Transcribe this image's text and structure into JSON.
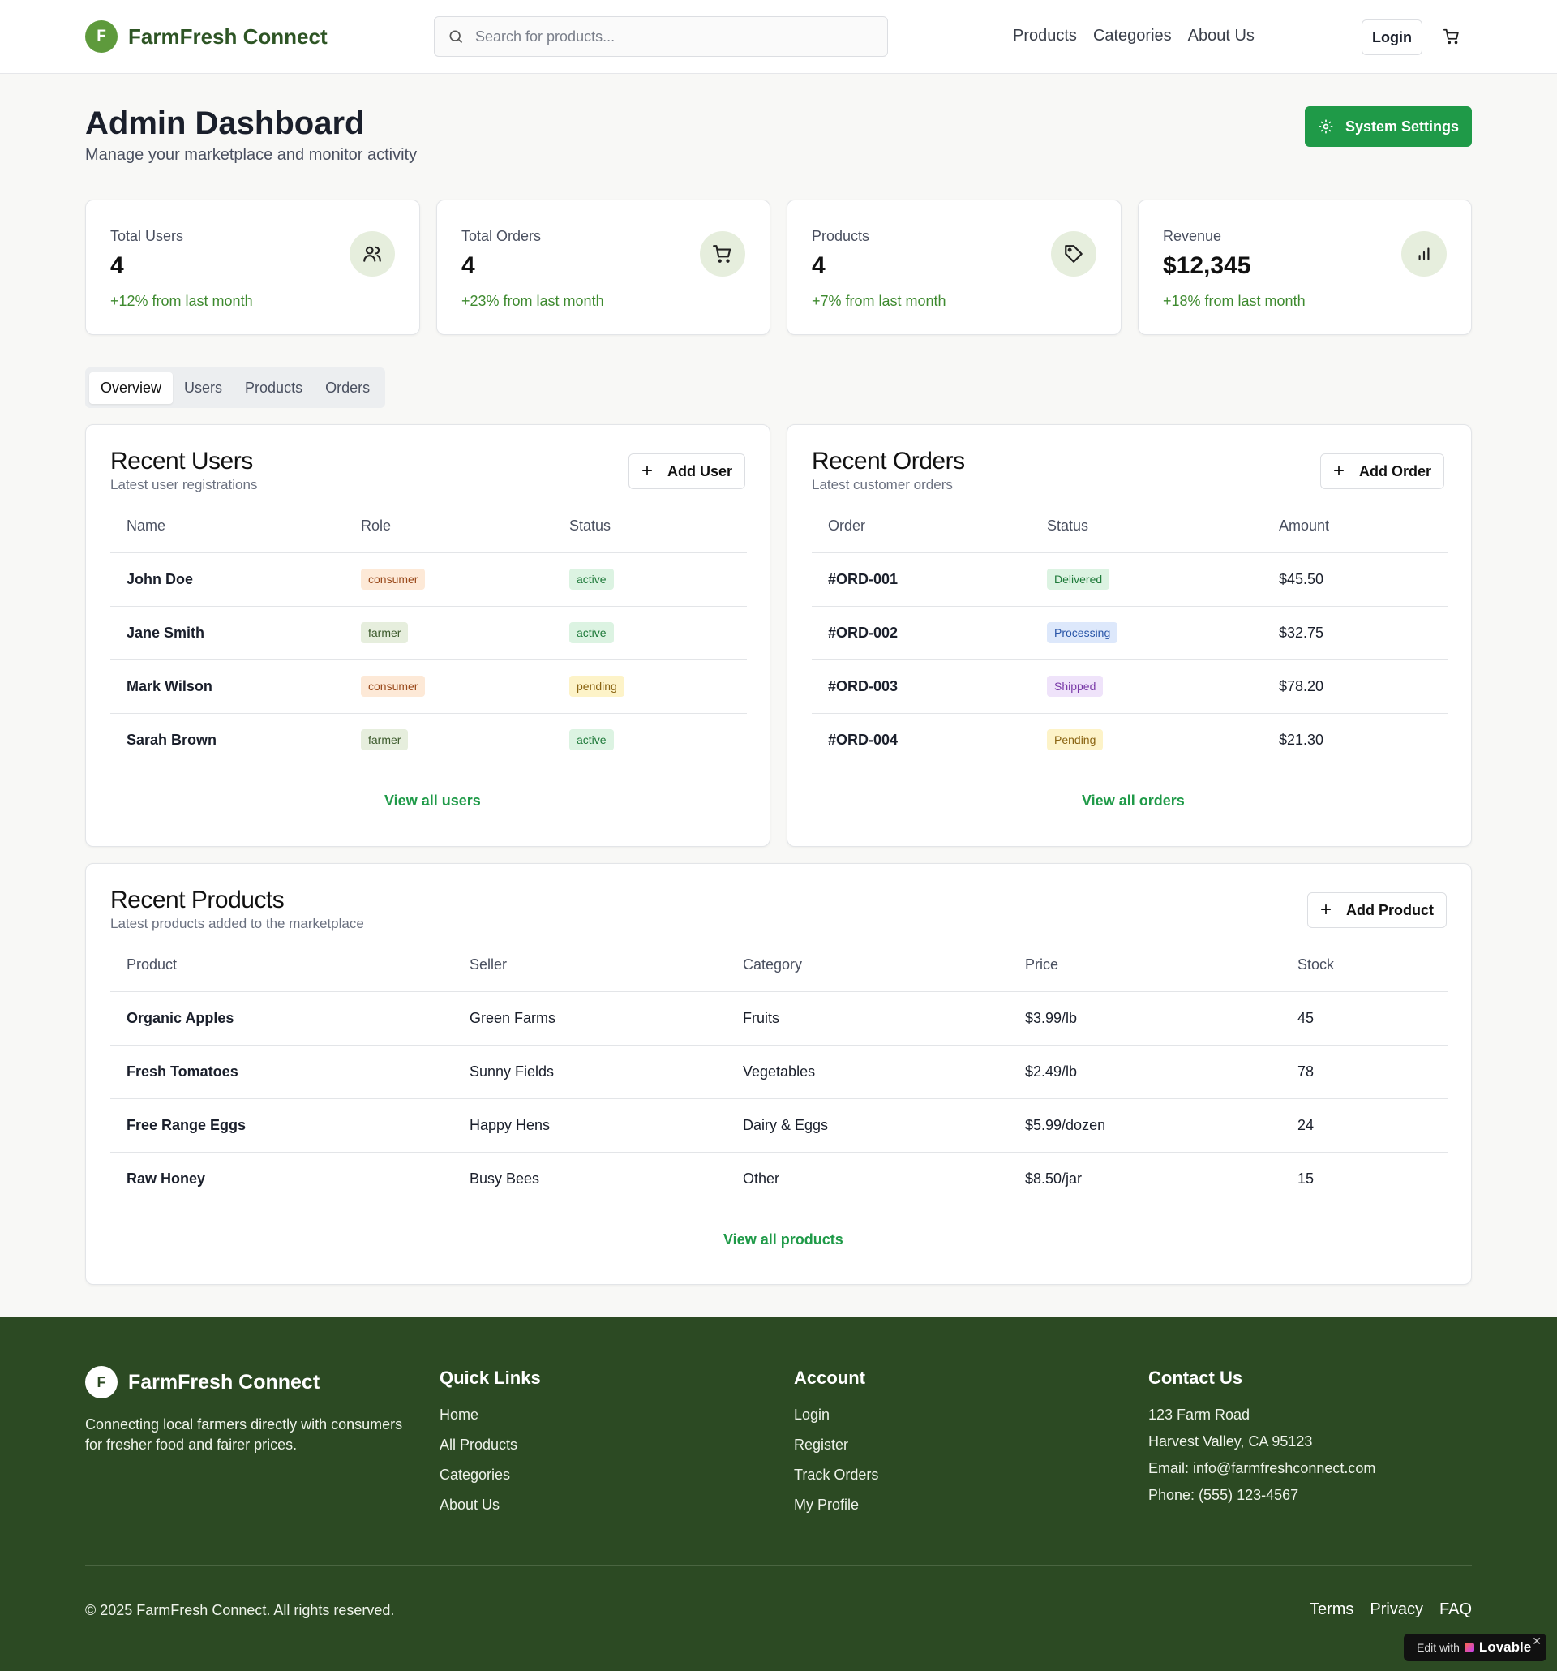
{
  "header": {
    "logo_letter": "F",
    "brand": "FarmFresh Connect",
    "search_placeholder": "Search for products...",
    "nav": [
      "Products",
      "Categories",
      "About Us"
    ],
    "login": "Login"
  },
  "page": {
    "title": "Admin Dashboard",
    "subtitle": "Manage your marketplace and monitor activity",
    "settings_button": "System Settings"
  },
  "stats": [
    {
      "label": "Total Users",
      "value": "4",
      "change": "+12% from last month",
      "icon": "users-icon"
    },
    {
      "label": "Total Orders",
      "value": "4",
      "change": "+23% from last month",
      "icon": "cart-icon"
    },
    {
      "label": "Products",
      "value": "4",
      "change": "+7% from last month",
      "icon": "tag-icon"
    },
    {
      "label": "Revenue",
      "value": "$12,345",
      "change": "+18% from last month",
      "icon": "bar-chart-icon"
    }
  ],
  "tabs": [
    "Overview",
    "Users",
    "Products",
    "Orders"
  ],
  "users": {
    "title": "Recent Users",
    "subtitle": "Latest user registrations",
    "add_label": "Add User",
    "headers": [
      "Name",
      "Role",
      "Status"
    ],
    "rows": [
      {
        "name": "John Doe",
        "role": "consumer",
        "status": "active"
      },
      {
        "name": "Jane Smith",
        "role": "farmer",
        "status": "active"
      },
      {
        "name": "Mark Wilson",
        "role": "consumer",
        "status": "pending"
      },
      {
        "name": "Sarah Brown",
        "role": "farmer",
        "status": "active"
      }
    ],
    "view_all": "View all users"
  },
  "orders": {
    "title": "Recent Orders",
    "subtitle": "Latest customer orders",
    "add_label": "Add Order",
    "headers": [
      "Order",
      "Status",
      "Amount"
    ],
    "rows": [
      {
        "id": "#ORD-001",
        "status": "Delivered",
        "amount": "$45.50"
      },
      {
        "id": "#ORD-002",
        "status": "Processing",
        "amount": "$32.75"
      },
      {
        "id": "#ORD-003",
        "status": "Shipped",
        "amount": "$78.20"
      },
      {
        "id": "#ORD-004",
        "status": "Pending",
        "amount": "$21.30"
      }
    ],
    "view_all": "View all orders"
  },
  "products": {
    "title": "Recent Products",
    "subtitle": "Latest products added to the marketplace",
    "add_label": "Add Product",
    "headers": [
      "Product",
      "Seller",
      "Category",
      "Price",
      "Stock"
    ],
    "rows": [
      {
        "product": "Organic Apples",
        "seller": "Green Farms",
        "category": "Fruits",
        "price": "$3.99/lb",
        "stock": "45"
      },
      {
        "product": "Fresh Tomatoes",
        "seller": "Sunny Fields",
        "category": "Vegetables",
        "price": "$2.49/lb",
        "stock": "78"
      },
      {
        "product": "Free Range Eggs",
        "seller": "Happy Hens",
        "category": "Dairy & Eggs",
        "price": "$5.99/dozen",
        "stock": "24"
      },
      {
        "product": "Raw Honey",
        "seller": "Busy Bees",
        "category": "Other",
        "price": "$8.50/jar",
        "stock": "15"
      }
    ],
    "view_all": "View all products"
  },
  "footer": {
    "brand": "FarmFresh Connect",
    "logo_letter": "F",
    "description": "Connecting local farmers directly with consumers for fresher food and fairer prices.",
    "quick_links_title": "Quick Links",
    "quick_links": [
      "Home",
      "All Products",
      "Categories",
      "About Us"
    ],
    "account_title": "Account",
    "account_links": [
      "Login",
      "Register",
      "Track Orders",
      "My Profile"
    ],
    "contact_title": "Contact Us",
    "contact": [
      "123 Farm Road",
      "Harvest Valley, CA 95123",
      "Email: info@farmfreshconnect.com",
      "Phone: (555) 123-4567"
    ],
    "copyright": "© 2025 FarmFresh Connect. All rights reserved.",
    "legal": [
      "Terms",
      "Privacy",
      "FAQ"
    ]
  },
  "lovable": {
    "edit": "Edit with",
    "brand": "Lovable",
    "close": "✕"
  },
  "colors": {
    "primary": "#1f9a48",
    "brand_dark": "#2c4a23",
    "role_consumer": "#fde9d7",
    "role_farmer": "#e6eedd",
    "status_active": "#dcf3e2",
    "status_pending": "#fdf3c8",
    "order_delivered": "#dcf3e2",
    "order_processing": "#dde8fb",
    "order_shipped": "#efe3fa",
    "order_pending": "#fdf3c8"
  }
}
